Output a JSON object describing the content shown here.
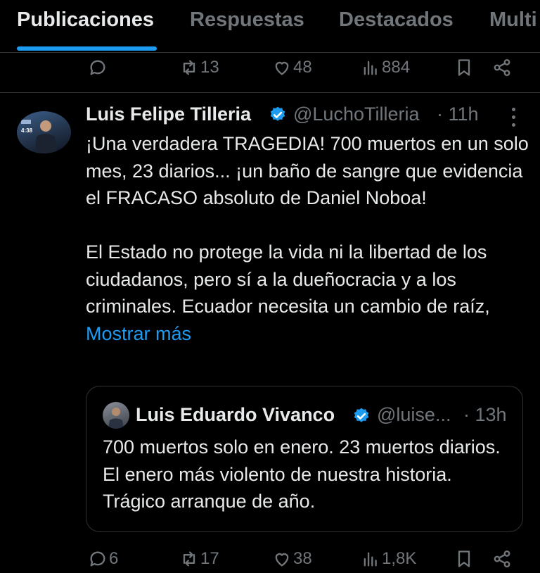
{
  "tabs": [
    {
      "label": "Publicaciones",
      "active": true
    },
    {
      "label": "Respuestas"
    },
    {
      "label": "Destacados"
    },
    {
      "label": "Multi"
    }
  ],
  "prev_post": {
    "reposts": "13",
    "likes": "48",
    "views": "884"
  },
  "post": {
    "author": "Luis Felipe Tilleria",
    "handle": "@LuchoTilleria",
    "time": "· 11h",
    "paragraph1": "¡Una verdadera TRAGEDIA! 700 muertos en un solo mes, 23 diarios... ¡un baño de sangre que evidencia el FRACASO absoluto de Daniel Noboa!",
    "paragraph2": "El Estado no protege la vida ni la libertad de los ciudadanos, pero sí a la dueñocracia y a los criminales. Ecuador necesita un cambio de raíz,",
    "show_more": "Mostrar más",
    "avatar_caption": "4:38",
    "replies": "6",
    "reposts": "17",
    "likes": "38",
    "views": "1,8K"
  },
  "quote": {
    "author": "Luis Eduardo Vivanco",
    "handle": "@luise...",
    "time": "· 13h",
    "text": "700 muertos solo en enero. 23 muertos diarios. El enero más violento de nuestra historia. Trágico arranque de año."
  },
  "colors": {
    "accent": "#1d9bf0",
    "muted": "#71767b",
    "text": "#e7e9ea",
    "border": "#2f3336"
  },
  "icons": [
    "reply-icon",
    "repost-icon",
    "like-icon",
    "views-icon",
    "bookmark-icon",
    "share-icon",
    "verified-badge-icon",
    "more-options-icon"
  ]
}
